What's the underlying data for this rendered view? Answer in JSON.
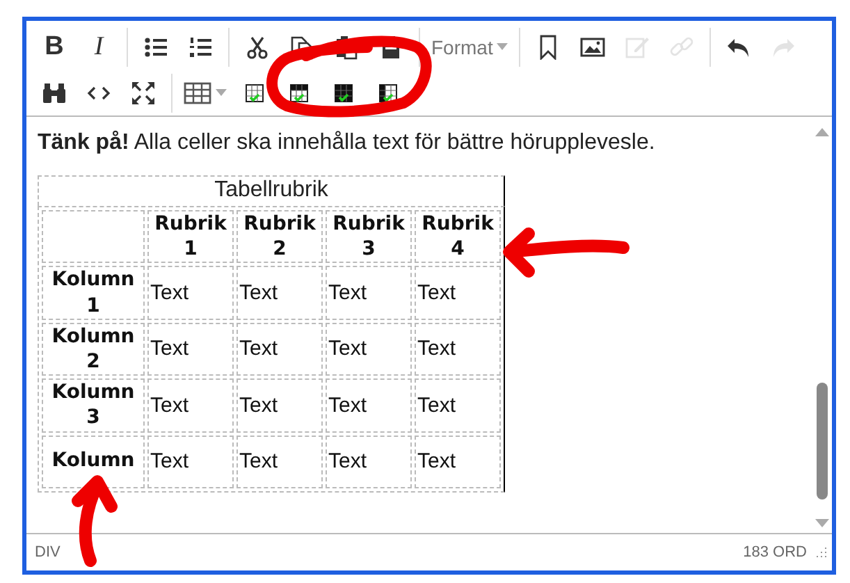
{
  "toolbar": [
    [
      {
        "kind": "text",
        "label": "B",
        "disabled": false
      },
      {
        "kind": "text",
        "label": "I",
        "disabled": false
      },
      {
        "kind": "separator"
      },
      {
        "kind": "button",
        "disabled": false
      },
      {
        "kind": "button",
        "disabled": false
      },
      {
        "kind": "separator"
      },
      {
        "kind": "button",
        "disabled": false
      },
      {
        "kind": "button",
        "disabled": false
      },
      {
        "kind": "button",
        "disabled": false
      },
      {
        "kind": "button",
        "disabled": false
      },
      {
        "kind": "separator"
      },
      {
        "kind": "dropdown",
        "label": "Format",
        "disabled": false
      },
      {
        "kind": "separator"
      },
      {
        "kind": "button",
        "disabled": false
      },
      {
        "kind": "button",
        "disabled": false
      },
      {
        "kind": "button",
        "disabled": true
      },
      {
        "kind": "button",
        "disabled": true
      },
      {
        "kind": "separator"
      },
      {
        "kind": "button",
        "disabled": false
      },
      {
        "kind": "button",
        "disabled": true
      }
    ],
    [
      {
        "kind": "button",
        "disabled": false
      },
      {
        "kind": "button",
        "disabled": false
      },
      {
        "kind": "button",
        "disabled": false
      },
      {
        "kind": "separator"
      },
      {
        "kind": "dropdown",
        "disabled": false
      },
      {
        "kind": "button",
        "disabled": false
      },
      {
        "kind": "button",
        "disabled": false
      },
      {
        "kind": "button",
        "disabled": false
      },
      {
        "kind": "button",
        "disabled": false
      }
    ]
  ],
  "content": {
    "note": "**Tänk på!** Alla celler ska innehålla text för bättre hörupplevesle.",
    "table": {
      "caption": "Tabellrubrik",
      "header": [
        "Rubrik 1",
        "Rubrik 2",
        "Rubrik 3",
        "Rubrik 4"
      ],
      "rows": [
        {
          "heading": "Kolumn 1",
          "cells": [
            "Text",
            "Text",
            "Text",
            "Text"
          ]
        },
        {
          "heading": "Kolumn 2",
          "cells": [
            "Text",
            "Text",
            "Text",
            "Text"
          ]
        },
        {
          "heading": "Kolumn 3",
          "cells": [
            "Text",
            "Text",
            "Text",
            "Text"
          ]
        },
        {
          "heading": "Kolumn",
          "cells": [
            "Text",
            "Text",
            "Text",
            "Text"
          ]
        }
      ]
    }
  },
  "status_bar": {
    "path": "DIV",
    "word_count": "183 ORD"
  }
}
